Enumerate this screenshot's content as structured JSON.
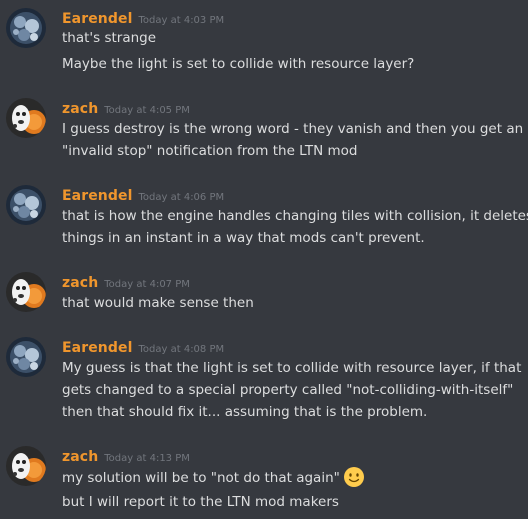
{
  "messages": [
    {
      "author": "Earendel",
      "time": "Today at 4:03 PM",
      "lines": [
        "that's strange",
        "Maybe the light is set to collide with resource layer?"
      ]
    },
    {
      "author": "zach",
      "time": "Today at 4:05 PM",
      "lines": [
        "I guess destroy is the wrong word - they vanish and then you get an",
        "\"invalid stop\" notification from the LTN mod"
      ]
    },
    {
      "author": "Earendel",
      "time": "Today at 4:06 PM",
      "lines": [
        "that is how the engine handles changing tiles with collision, it deletes",
        "things in an instant in a way that mods can't prevent."
      ]
    },
    {
      "author": "zach",
      "time": "Today at 4:07 PM",
      "lines": [
        "that would make sense then"
      ]
    },
    {
      "author": "Earendel",
      "time": "Today at 4:08 PM",
      "lines": [
        "My guess is that the light is set to collide with resource layer, if that",
        "gets changed to a special property called \"not-colliding-with-itself\"",
        "then that should fix it... assuming that is the problem."
      ]
    },
    {
      "author": "zach",
      "time": "Today at 4:13 PM",
      "lines": [
        "my solution will be to \"not do that again\"",
        "but I will report it to the LTN mod makers"
      ],
      "emoji": "slightly-smiling-face-icon"
    }
  ],
  "colors": {
    "background": "#36393f",
    "username": "#f0962d",
    "timestamp": "#72767d",
    "text": "#dcddde"
  }
}
